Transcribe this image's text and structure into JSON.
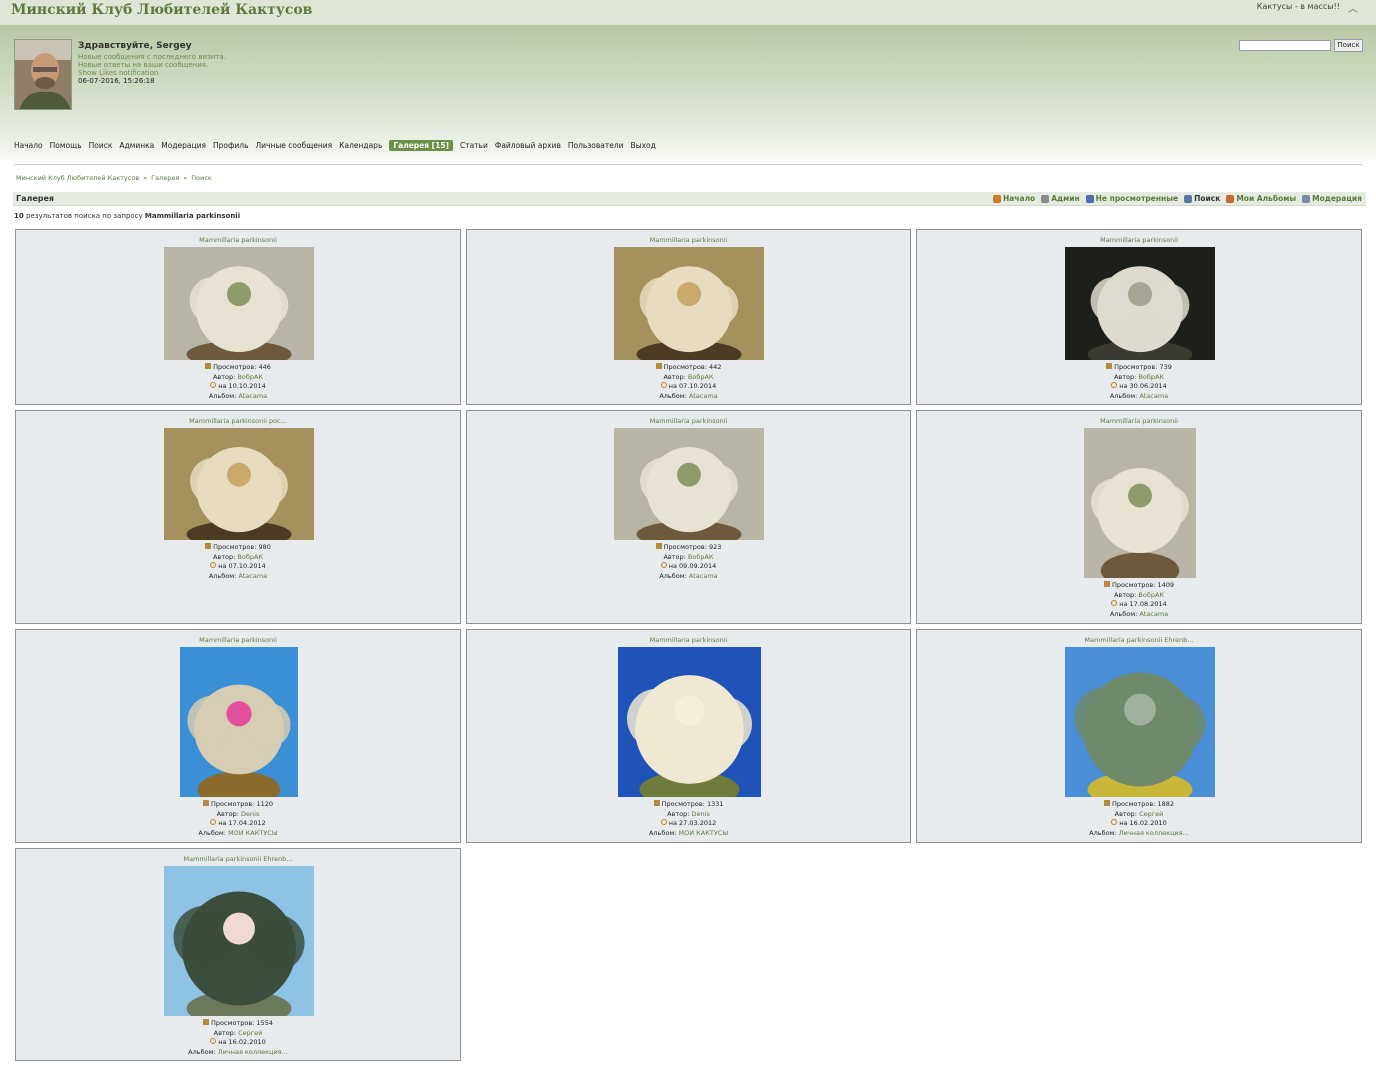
{
  "header": {
    "site_title": "Минский Клуб Любителей Кактусов",
    "tagline": "Кактусы - в массы!!",
    "collapse_icon": "chevron-up-icon",
    "welcome": "Здравствуйте, Sergey",
    "new_posts_link": "Новые сообщения с последнего визита.",
    "new_replies_link": "Новые ответы на ваши сообщения.",
    "likes_link": "Show Likes notification",
    "datetime": "06-07-2016, 15:26:18",
    "search_value": "",
    "search_button": "Поиск"
  },
  "nav": [
    {
      "label": "Начало"
    },
    {
      "label": "Помощь"
    },
    {
      "label": "Поиск"
    },
    {
      "label": "Админка"
    },
    {
      "label": "Модерация"
    },
    {
      "label": "Профиль"
    },
    {
      "label": "Личные сообщения"
    },
    {
      "label": "Календарь"
    },
    {
      "label": "Галерея [15]",
      "active": true
    },
    {
      "label": "Статьи"
    },
    {
      "label": "Файловый архив"
    },
    {
      "label": "Пользователи"
    },
    {
      "label": "Выход"
    }
  ],
  "breadcrumb": [
    "Минский Клуб Любителей Кактусов",
    "»",
    "Галерея",
    "»",
    "Поиск"
  ],
  "gallery": {
    "title": "Галерея",
    "subnav": [
      {
        "label": "Начало",
        "icon": "home-icon",
        "color": "#c97a2a"
      },
      {
        "label": "Админ",
        "icon": "gear-icon",
        "color": "#8a8a8a"
      },
      {
        "label": "Не просмотренные",
        "icon": "eye-icon",
        "color": "#4c6fa8"
      },
      {
        "label": "Поиск",
        "icon": "magnifier-icon",
        "color": "#5578a6",
        "current": true
      },
      {
        "label": "Мои Альбомы",
        "icon": "user-icon",
        "color": "#c46b2c"
      },
      {
        "label": "Модерация",
        "icon": "document-icon",
        "color": "#7a8aa0"
      }
    ],
    "results_count": "10",
    "results_text": "результатов поиска по запросу",
    "query": "Mammillaria parkinsonii"
  },
  "labels": {
    "views": "Просмотров:",
    "author": "Автор:",
    "date_prefix": "на",
    "album": "Альбом:"
  },
  "items": [
    {
      "title": "Mammillaria parkinsonii",
      "views": "446",
      "author": "ВобрАК",
      "date": "10.10.2014",
      "album": "Atacama",
      "palette": "grey"
    },
    {
      "title": "Mammillaria parkinsonii",
      "views": "442",
      "author": "ВобрАК",
      "date": "07.10.2014",
      "album": "Atacama",
      "palette": "tan"
    },
    {
      "title": "Mammillaria parkinsonii",
      "views": "739",
      "author": "ВобрАК",
      "date": "30.06.2014",
      "album": "Atacama",
      "palette": "dark"
    },
    {
      "title": "Mammillaria parkinsonii рос...",
      "views": "980",
      "author": "ВобрАК",
      "date": "07.10.2014",
      "album": "Atacama",
      "palette": "tan"
    },
    {
      "title": "Mammillaria parkinsonii",
      "views": "923",
      "author": "ВобрАК",
      "date": "09.09.2014",
      "album": "Atacama",
      "palette": "grey"
    },
    {
      "title": "Mammillaria parkinsonii",
      "views": "1409",
      "author": "ВобрАК",
      "date": "17.08.2014",
      "album": "Atacama",
      "palette": "grey"
    },
    {
      "title": "Mammillaria parkinsonii",
      "views": "1120",
      "author": "Denis",
      "date": "17.04.2012",
      "album": "МОИ КАКТУСЫ",
      "palette": "blue-pink"
    },
    {
      "title": "Mammillaria parkinsonii",
      "views": "1331",
      "author": "Denis",
      "date": "27.03.2012",
      "album": "МОИ КАКТУСЫ",
      "palette": "blue-white"
    },
    {
      "title": "Mammillaria parkinsonii Ehrenb...",
      "views": "1882",
      "author": "Сергей",
      "date": "16.02.2010",
      "album": "Личная коллекция...",
      "palette": "blue-green"
    },
    {
      "title": "Mammillaria parkinsonii Ehrenb...",
      "views": "1554",
      "author": "Сергей",
      "date": "16.02.2010",
      "album": "Личная коллекция...",
      "palette": "lightblue-flower"
    }
  ]
}
